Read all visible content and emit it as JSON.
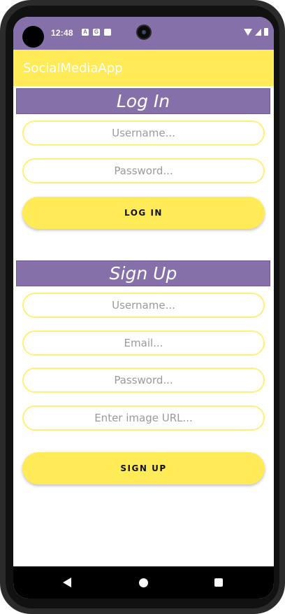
{
  "status_bar": {
    "time": "12:48",
    "notification_icons": [
      "A",
      "G",
      "sd-card-icon"
    ],
    "system_icons": [
      "wifi-icon",
      "signal-icon",
      "battery-icon"
    ]
  },
  "app_bar": {
    "title": "SocialMediaApp",
    "color": "#ffeb57"
  },
  "login": {
    "header": "Log In",
    "username_placeholder": "Username...",
    "password_placeholder": "Password...",
    "button_label": "LOG IN"
  },
  "signup": {
    "header": "Sign Up",
    "username_placeholder": "Username...",
    "email_placeholder": "Email...",
    "password_placeholder": "Password...",
    "image_url_placeholder": "Enter image URL...",
    "button_label": "SIGN UP"
  },
  "nav_bar": {
    "buttons": [
      "back-icon",
      "home-icon",
      "recents-icon"
    ]
  },
  "colors": {
    "header_purple": "#8670a9",
    "accent_yellow": "#ffeb57"
  }
}
